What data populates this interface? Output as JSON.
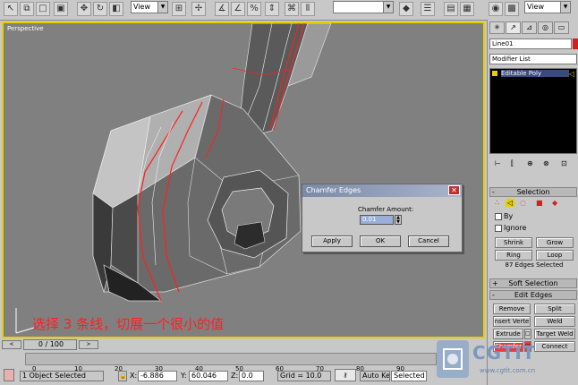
{
  "toolbar": {
    "view_select": "View",
    "view_select_right": "View"
  },
  "viewport": {
    "label": "Perspective"
  },
  "command_panel": {
    "object_name": "Line01",
    "modifier_list": "Modifier List",
    "stack_item": "Editable Poly",
    "selection_rollout": "Selection",
    "by_label": "By",
    "ignore_label": "Ignore",
    "shrink": "Shrink",
    "grow": "Grow",
    "ring": "Ring",
    "loop": "Loop",
    "edges_selected": "87 Edges Selected",
    "soft_selection": "Soft Selection",
    "edit_edges": "Edit Edges",
    "remove": "Remove",
    "split": "Split",
    "insert_vertex": "nsert Verte",
    "weld": "Weld",
    "extrude": "Extrude",
    "target_weld": "Target Weld",
    "chamfer": "Chamfer",
    "connect": "Connect"
  },
  "dialog": {
    "title": "Chamfer Edges",
    "amount_label": "Chamfer Amount:",
    "amount_value": "0.01",
    "apply": "Apply",
    "ok": "OK",
    "cancel": "Cancel",
    "close": "✕"
  },
  "caption": "选择 3 条线，切展一个很小的值",
  "status": {
    "frame_counter": "0 / 100",
    "timeline_ticks": [
      "0",
      "10",
      "20",
      "30",
      "40",
      "50",
      "60",
      "70",
      "80",
      "90"
    ],
    "object_selected": "1 Object Selected",
    "x_label": "X:",
    "x_value": "-6.886",
    "y_label": "Y:",
    "y_value": "60.046",
    "z_label": "Z:",
    "z_value": "0.0",
    "grid": "Grid = 10.0",
    "auto_key": "Auto Key",
    "selected": "Selected"
  },
  "watermark": {
    "brand": "CGTIT",
    "url": "www.cgtit.com.cn"
  },
  "colors": {
    "viewport_bg": "#808080",
    "active_border": "#e8d000",
    "selected_edges": "#ff2020",
    "panel_bg": "#c8c8c8"
  }
}
